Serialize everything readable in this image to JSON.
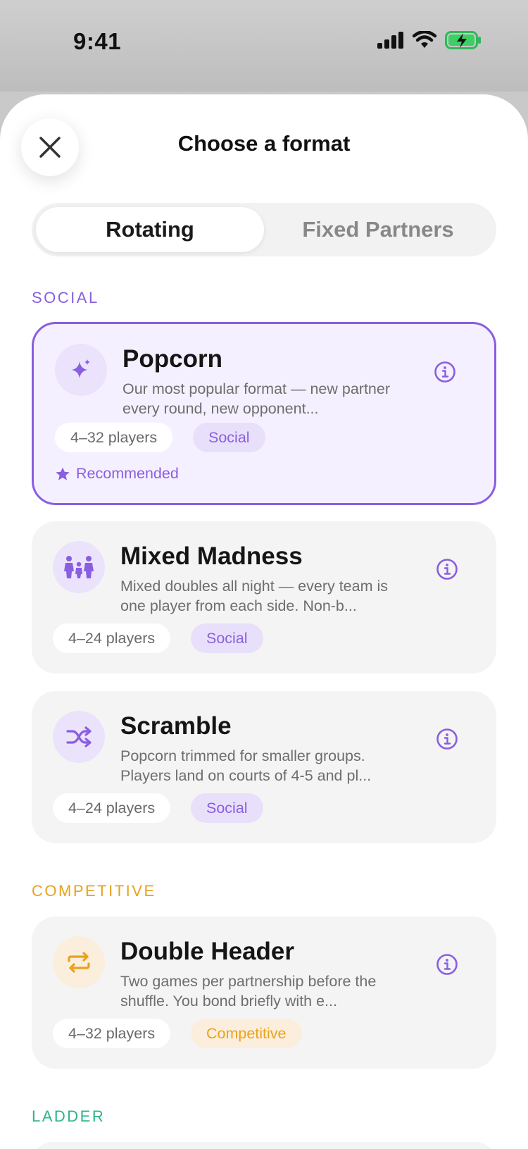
{
  "status_bar": {
    "time": "9:41"
  },
  "header": {
    "title": "Choose a format"
  },
  "tabs": [
    {
      "label": "Rotating",
      "active": true
    },
    {
      "label": "Fixed Partners",
      "active": false
    }
  ],
  "sections": {
    "social": {
      "label": "SOCIAL",
      "color": "#8a5ee0"
    },
    "competitive": {
      "label": "COMPETITIVE",
      "color": "#e9a21c"
    },
    "ladder": {
      "label": "LADDER",
      "color": "#2bb58a"
    }
  },
  "formats": [
    {
      "title": "Popcorn",
      "description": "Our most popular format — new partner every round, new opponent...",
      "players": "4–32 players",
      "tag": "Social",
      "icon": "sparkles-icon",
      "recommended": "Recommended"
    },
    {
      "title": "Mixed Madness",
      "description": "Mixed doubles all night — every team is one player from each side. Non-b...",
      "players": "4–24 players",
      "tag": "Social",
      "icon": "family-icon"
    },
    {
      "title": "Scramble",
      "description": "Popcorn trimmed for smaller groups. Players land on courts of 4-5 and pl...",
      "players": "4–24 players",
      "tag": "Social",
      "icon": "shuffle-icon"
    },
    {
      "title": "Double Header",
      "description": "Two games per partnership before the shuffle. You bond briefly with e...",
      "players": "4–32 players",
      "tag": "Competitive",
      "icon": "repeat-icon"
    }
  ],
  "colors": {
    "accent": "#8a5ee0",
    "competitive": "#e9a21c",
    "ladder": "#2bb58a"
  }
}
